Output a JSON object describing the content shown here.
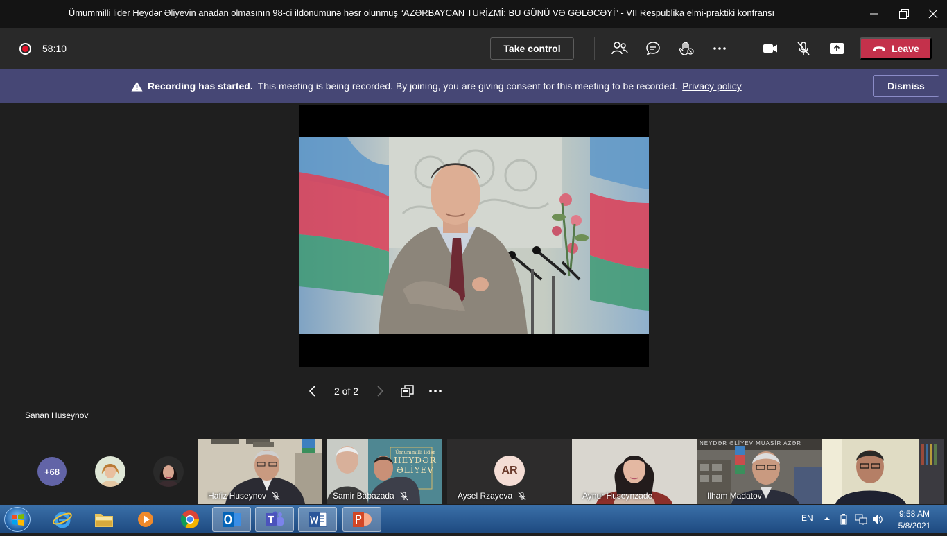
{
  "window": {
    "title": "Ümummilli lider Heydər Əliyevin anadan olmasının 98-ci ildönümünə həsr olunmuş “AZƏRBAYCAN TURİZMİ: BU GÜNÜ VƏ GƏLƏCƏYİ” - VII Respublika elmi-praktiki konfransı"
  },
  "toolbar": {
    "timer": "58:10",
    "take_control": "Take control",
    "leave": "Leave"
  },
  "banner": {
    "bold": "Recording has started.",
    "message": "This meeting is being recorded. By joining, you are giving consent for this meeting to be recorded.",
    "link": "Privacy policy",
    "dismiss": "Dismiss"
  },
  "stage": {
    "page": "2 of 2",
    "presenter": "Sanan Huseynov"
  },
  "participants": {
    "more": "+68",
    "tiles": [
      {
        "name": "Hafiz Huseynov"
      },
      {
        "name": "Samir Babazada"
      },
      {
        "name": "Aysel Rzayeva",
        "initials": "AR"
      },
      {
        "name": "Aynur Huseynzade"
      },
      {
        "name": "Ilham Madatov"
      }
    ],
    "book_line1": "Ümummilli lider",
    "book_line2": "HEYDƏR",
    "book_line3": "ƏLİYEV",
    "banner_text": "NEYDƏR  ƏLİYEV  MUASİR  AZƏR"
  },
  "taskbar": {
    "lang": "EN",
    "time": "9:58 AM",
    "date": "5/8/2021"
  },
  "colors": {
    "accent": "#6264a7",
    "leave": "#c4314b",
    "banner": "#464775"
  }
}
